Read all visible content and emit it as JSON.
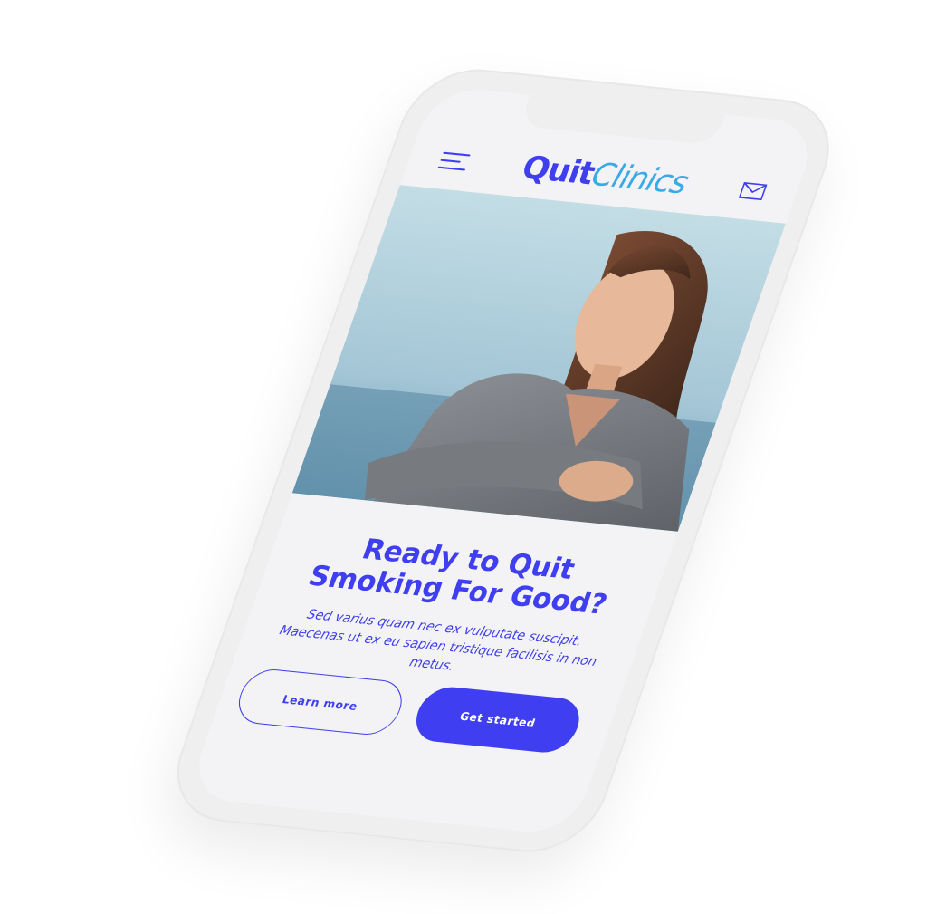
{
  "brand": {
    "logo_part1": "Quit",
    "logo_part2": "Clinics",
    "primary_color": "#3f3ef0",
    "secondary_color": "#3aa9e8"
  },
  "header": {
    "menu_icon": "hamburger-menu-icon",
    "mail_icon": "envelope-icon"
  },
  "hero": {
    "image": "smiling woman sitting outdoors by the sea"
  },
  "content": {
    "headline": "Ready to Quit Smoking For Good?",
    "body": "Sed varius quam nec ex vulputate suscipit. Maecenas ut ex eu sapien tristique facilisis in non metus."
  },
  "buttons": {
    "learn_more": "Learn more",
    "get_started": "Get started"
  }
}
